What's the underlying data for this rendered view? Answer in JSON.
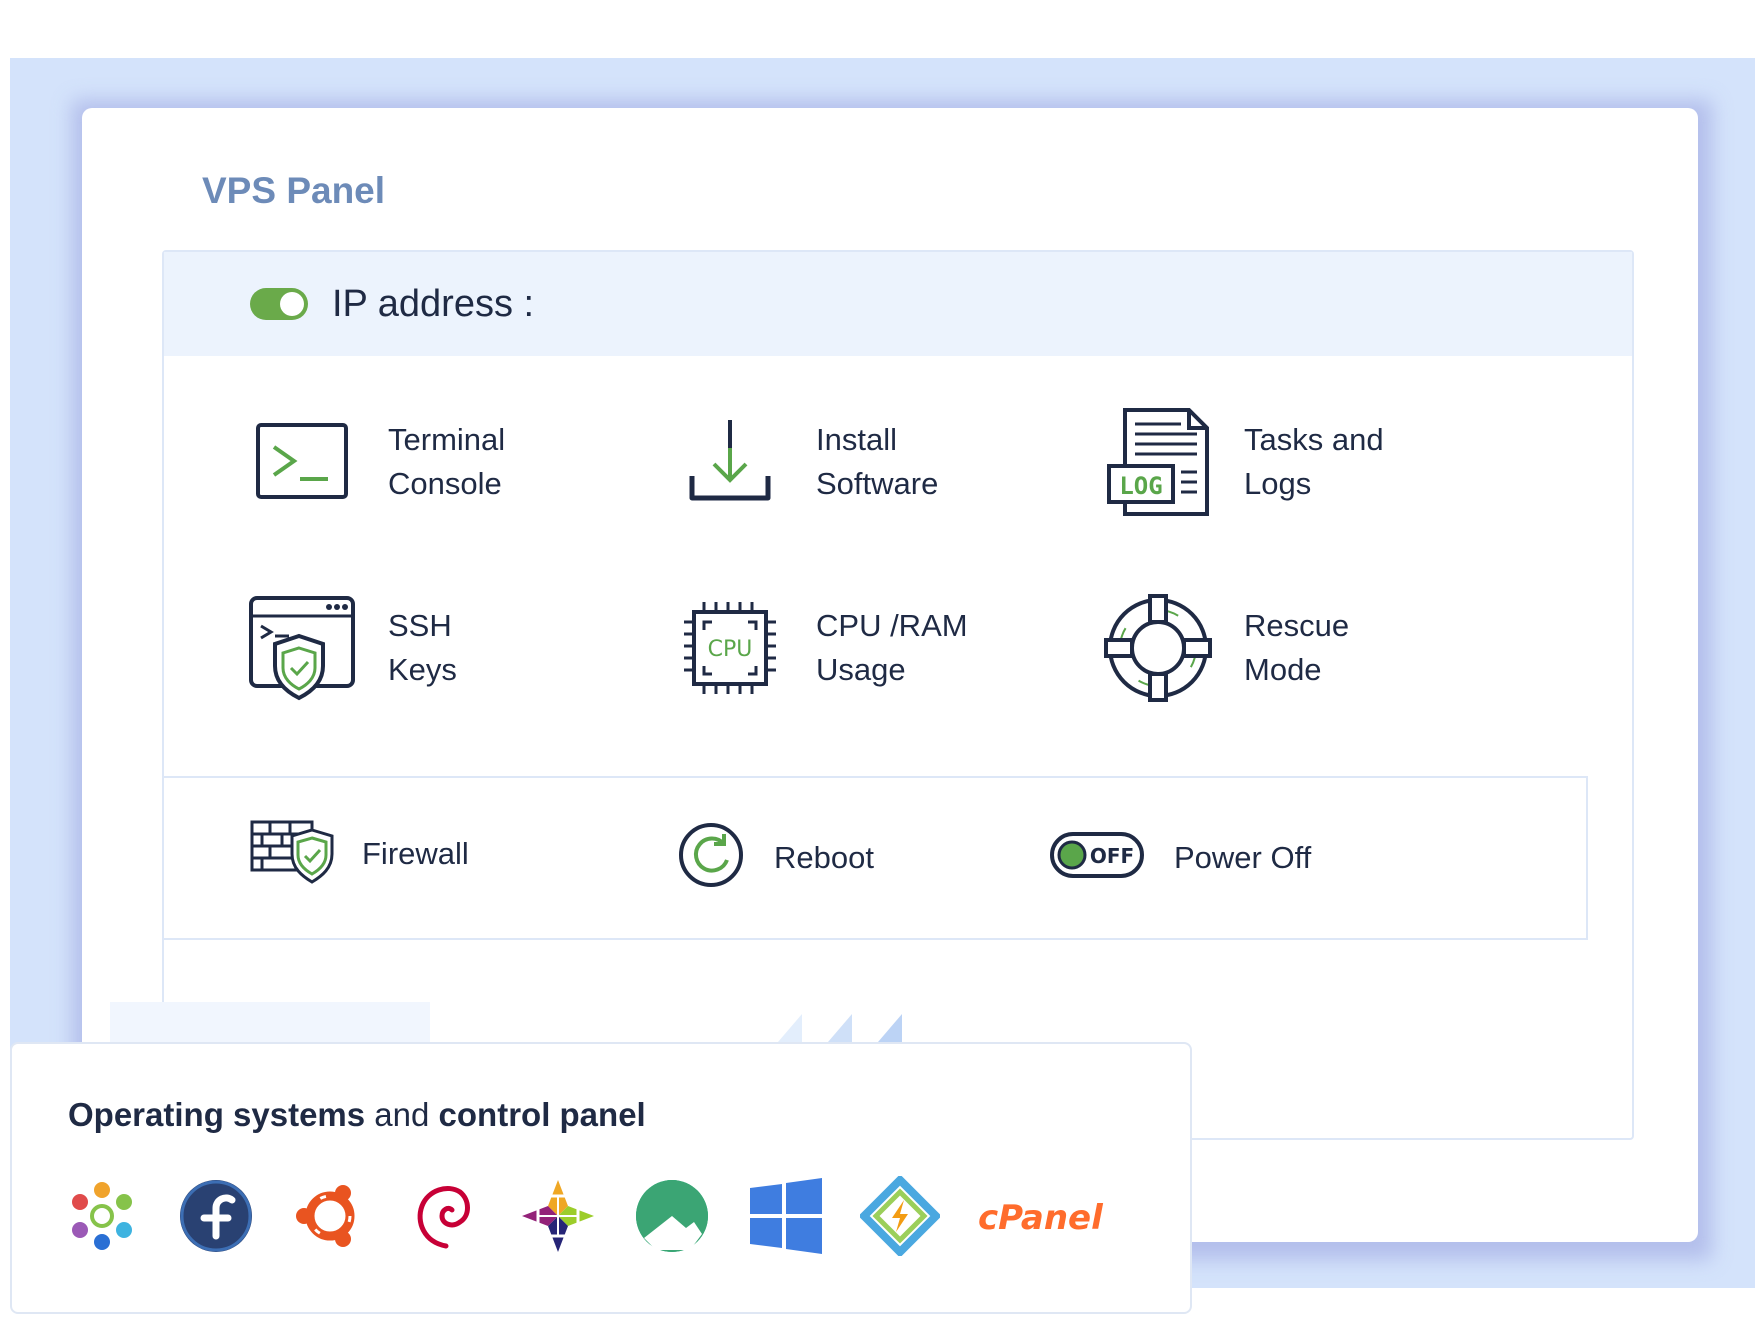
{
  "panel": {
    "title": "VPS Panel"
  },
  "ip": {
    "label": "IP address :",
    "toggle_on": true,
    "toggle_color": "#6aaa4a"
  },
  "features": [
    {
      "key": "terminal",
      "label": "Terminal\nConsole",
      "icon": "terminal-icon"
    },
    {
      "key": "install",
      "label": "Install\nSoftware",
      "icon": "download-icon"
    },
    {
      "key": "tasks",
      "label": "Tasks and\nLogs",
      "icon": "log-file-icon",
      "icon_text": "LOG"
    },
    {
      "key": "ssh",
      "label": "SSH\nKeys",
      "icon": "ssh-shield-icon"
    },
    {
      "key": "cpu",
      "label": "CPU /RAM\nUsage",
      "icon": "cpu-chip-icon",
      "icon_text": "CPU"
    },
    {
      "key": "rescue",
      "label": "Rescue\nMode",
      "icon": "lifebuoy-icon"
    }
  ],
  "actions": [
    {
      "key": "firewall",
      "label": "Firewall",
      "icon": "firewall-icon"
    },
    {
      "key": "reboot",
      "label": "Reboot",
      "icon": "reboot-icon"
    },
    {
      "key": "poweroff",
      "label": "Power Off",
      "icon": "power-toggle-icon",
      "icon_text": "OFF"
    }
  ],
  "os": {
    "title_bold1": "Operating systems",
    "title_mid": " and ",
    "title_bold2": "control panel",
    "logos": [
      "almalinux-logo",
      "fedora-logo",
      "ubuntu-logo",
      "debian-logo",
      "centos-logo",
      "rockylinux-logo",
      "windows-logo",
      "virtualizor-logo",
      "cpanel-logo"
    ],
    "cpanel_text": "cPanel"
  },
  "colors": {
    "accent_green": "#5aa64a",
    "icon_navy": "#1f2a44",
    "title_blue": "#6d8bb8",
    "back_slab": "#d4e3fb"
  }
}
